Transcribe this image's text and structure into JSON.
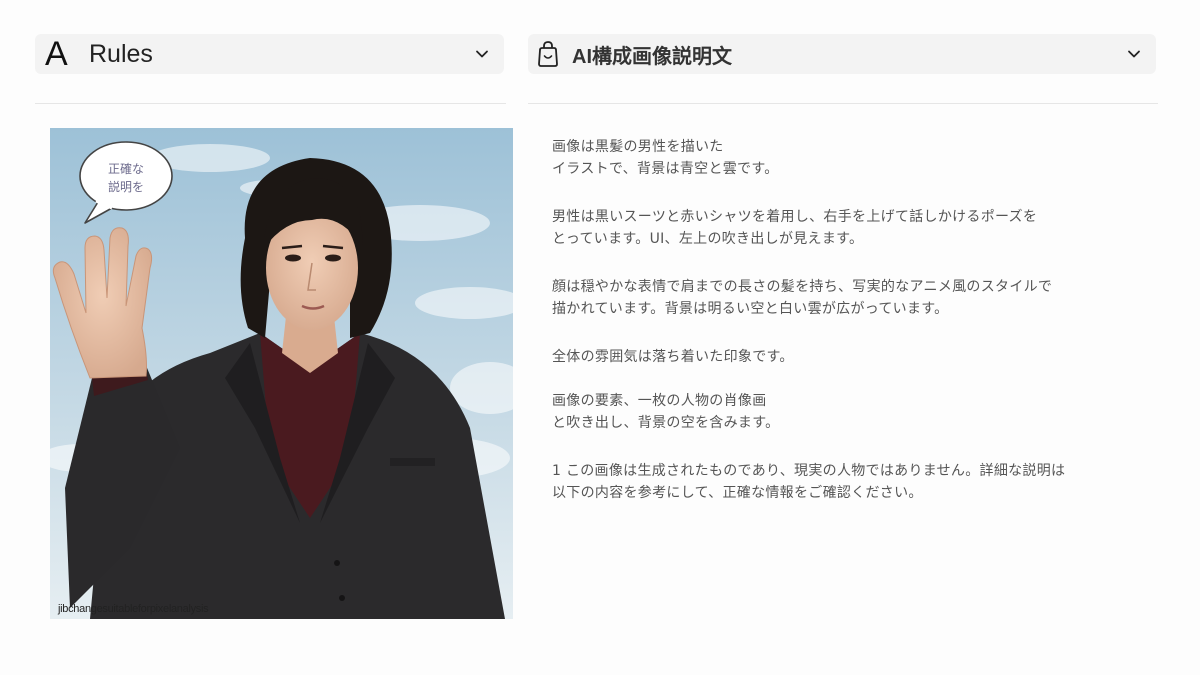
{
  "left_panel": {
    "logo": "A",
    "title": "Rules",
    "chevron_icon": "chevron-down-icon"
  },
  "right_panel": {
    "icon": "shopping-bag-icon",
    "title": "AI構成画像説明文",
    "chevron_icon": "chevron-down-icon"
  },
  "portrait": {
    "bubble_text_line1": "正確な",
    "bubble_text_line2": "説明を",
    "caption": "jibchangesuitableforpixelanalysis"
  },
  "paragraphs": [
    "画像は黒髪の男性を描いた\nイラストで、背景は青空と雲です。",
    "男性は黒いスーツと赤いシャツを着用し、右手を上げて話しかけるポーズを\nとっています。UI、左上の吹き出しが見えます。",
    "顔は穏やかな表情で肩までの長さの髪を持ち、写実的なアニメ風のスタイルで\n描かれています。背景は明るい空と白い雲が広がっています。",
    "全体の雰囲気は落ち着いた印象です。",
    "画像の要素、一枚の人物の肖像画\nと吹き出し、背景の空を含みます。",
    "1 この画像は生成されたものであり、現実の人物ではありません。詳細な説明は\n以下の内容を参考にして、正確な情報をご確認ください。"
  ],
  "colors": {
    "sky_top": "#9fc3d8",
    "sky_bottom": "#e4edf1",
    "suit": "#2b2a2c",
    "shirt": "#4a1a1f",
    "hair": "#1c1714",
    "skin": "#e7c1a6"
  }
}
